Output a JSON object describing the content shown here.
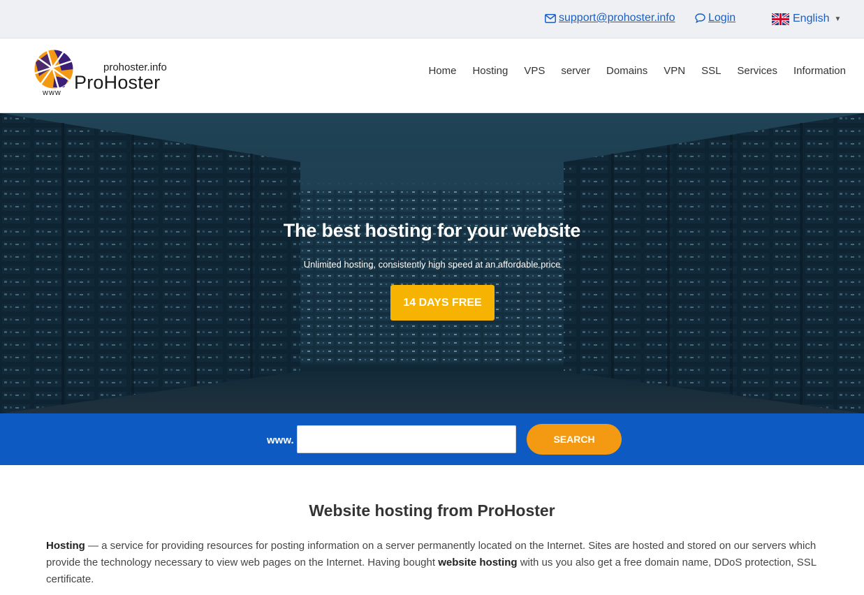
{
  "topbar": {
    "email": "support@prohoster.info",
    "login": "Login",
    "language": "English"
  },
  "logo": {
    "domain": "prohoster.info",
    "brand": "ProHoster",
    "www": "www"
  },
  "nav": [
    "Home",
    "Hosting",
    "VPS",
    "server",
    "Domains",
    "VPN",
    "SSL",
    "Services",
    "Information"
  ],
  "hero": {
    "title": "The best hosting for your website",
    "subtitle": "Unlimited hosting, consistently high speed at an affordable price",
    "cta": "14 DAYS FREE"
  },
  "domain_search": {
    "prefix": "www.",
    "input_value": "",
    "button": "SEARCH"
  },
  "content": {
    "title": "Website hosting from ProHoster",
    "intro_term": "Hosting",
    "intro_part1": " — a service for providing resources for posting information on a server permanently located on the Internet. Sites are hosted and stored on our servers which provide the technology necessary to view web pages on the Internet. Having bought ",
    "intro_term2": "website hosting",
    "intro_part2": " with us you also get a free domain name, DDoS protection, SSL certificate."
  },
  "colors": {
    "link": "#1b5fc1",
    "cta": "#f7b301",
    "search_band": "#0c5ac2",
    "search_button": "#f39a12"
  },
  "icons": [
    "envelope-icon",
    "chat-bubble-icon",
    "uk-flag-icon",
    "caret-down-icon",
    "logo-globe-icon"
  ]
}
